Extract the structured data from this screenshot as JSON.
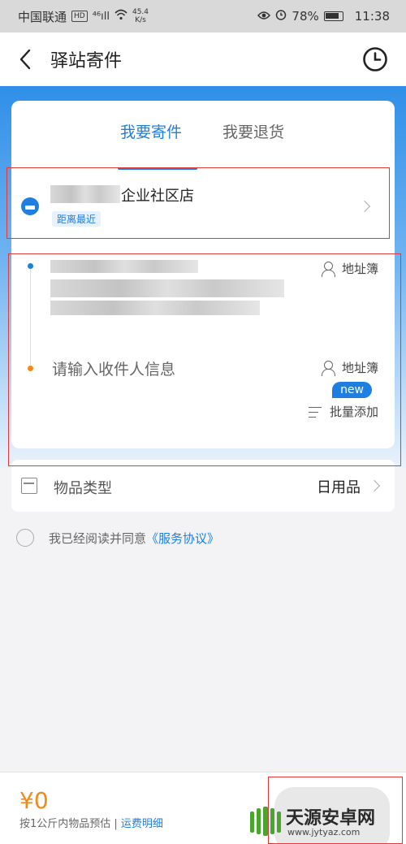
{
  "status": {
    "carrier": "中国联通",
    "hd": "HD",
    "signal": "⁴⁶ıll",
    "speed_top": "45.4",
    "speed_bottom": "K/s",
    "battery": "78%",
    "time": "11:38"
  },
  "header": {
    "title": "驿站寄件"
  },
  "tabs": [
    {
      "label": "我要寄件"
    },
    {
      "label": "我要退货"
    }
  ],
  "store": {
    "name": "企业社区店",
    "tag": "距离最近"
  },
  "addr": {
    "recipient_placeholder": "请输入收件人信息",
    "address_book": "地址簿",
    "new_badge": "new",
    "batch_add": "批量添加"
  },
  "goods": {
    "label": "物品类型",
    "value": "日用品"
  },
  "agreement": {
    "text": "我已经阅读并同意",
    "link": "《服务协议》"
  },
  "bottom": {
    "price": "¥0",
    "estimate": "按1公斤内物品预估 | ",
    "fee_detail": "运费明细"
  },
  "watermark": {
    "title": "天源安卓网",
    "url": "www.jytyaz.com"
  },
  "colors": {
    "accent": "#1f7fe0",
    "orange": "#f28a1a",
    "red_highlight": "#e23a3a"
  }
}
